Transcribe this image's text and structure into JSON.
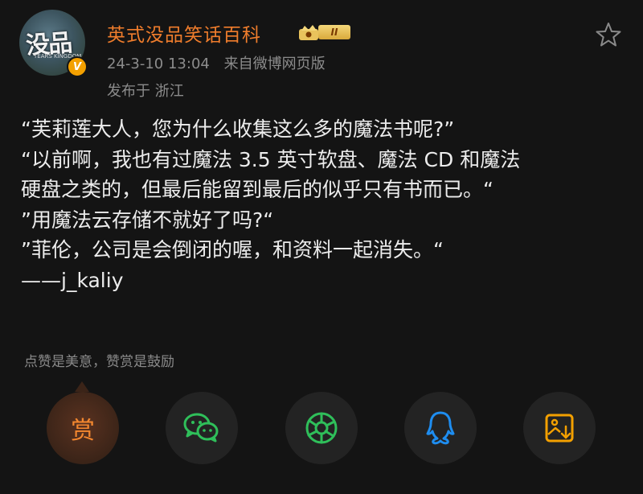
{
  "header": {
    "avatar_logo_text": "没品",
    "avatar_logo_sub": "TEARS KINGDOM",
    "username": "英式没品笑话百科",
    "level_badge": "II",
    "timestamp": "24-3-10 13:04",
    "source": "来自微博网页版",
    "location": "发布于 浙江",
    "verified_mark": "V"
  },
  "post": {
    "lines": [
      "“芙莉莲大人，您为什么收集这么多的魔法书呢?”",
      "“以前啊，我也有过魔法 3.5 英寸软盘、魔法 CD 和魔法",
      "硬盘之类的，但最后能留到最后的似乎只有书而已。“",
      "”用魔法云存储不就好了吗?“",
      "”菲伦，公司是会倒闭的喔，和资料一起消失。“",
      "——j_kaliy"
    ]
  },
  "tip": "点赞是美意，赞赏是鼓励",
  "actions": {
    "reward_label": "赏",
    "icons": [
      "reward-button",
      "wechat-icon",
      "moments-icon",
      "qq-icon",
      "save-image-icon"
    ]
  },
  "colors": {
    "background": "#141414",
    "username": "#f07d2c",
    "meta": "#8c8c8c",
    "wechat": "#2fbf5a",
    "moments": "#2fbf5a",
    "qq": "#1e8df0",
    "save": "#f3a000",
    "reward": "#f3872f"
  }
}
